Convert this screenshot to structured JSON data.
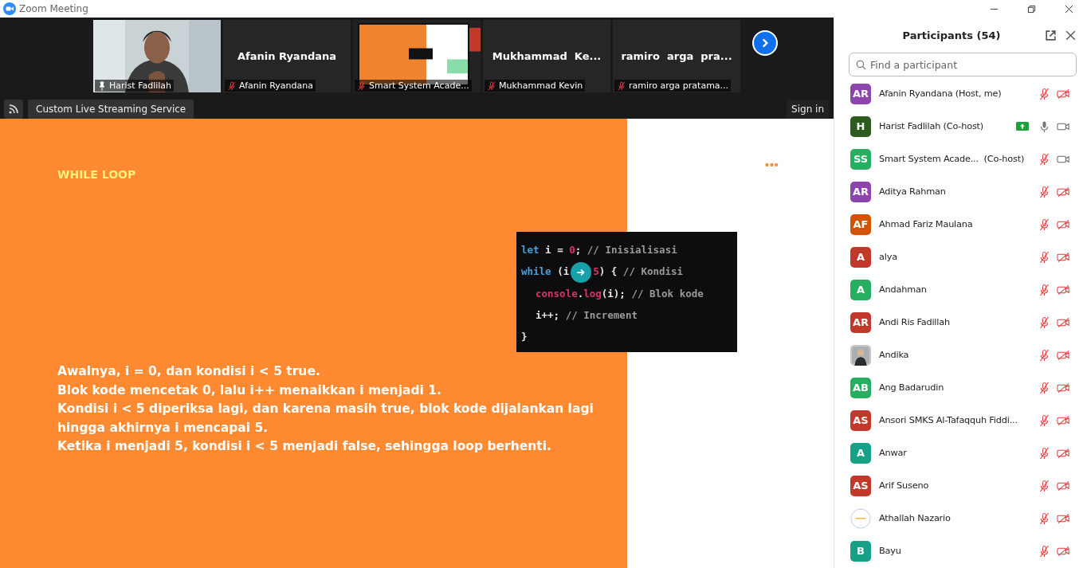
{
  "window": {
    "title": "Zoom Meeting"
  },
  "gallery": [
    {
      "kind": "video",
      "name": "Harist Fadlilah",
      "pinned": true,
      "muted": false,
      "active": true
    },
    {
      "kind": "name",
      "title": "Afanin Ryandana",
      "name": "Afanin Ryandana",
      "pinned": false,
      "muted": true,
      "active": false
    },
    {
      "kind": "screen",
      "name": "Smart System Acade...",
      "pinned": false,
      "muted": true,
      "active": false
    },
    {
      "kind": "name",
      "title": "Mukhammad  Ke...",
      "name": "Mukhammad Kevin",
      "pinned": false,
      "muted": true,
      "active": false
    },
    {
      "kind": "name",
      "title": "ramiro  arga  pra...",
      "name": "ramiro arga pratama...",
      "pinned": false,
      "muted": true,
      "active": false
    }
  ],
  "streaming": {
    "label": "Custom Live Streaming Service"
  },
  "sign_in": "Sign in",
  "slide": {
    "heading": "WHILE LOOP",
    "more": "•••",
    "code": [
      [
        {
          "kind": "keyword",
          "text": "let"
        },
        {
          "kind": "plain",
          "text": " i = "
        },
        {
          "kind": "number",
          "text": "0"
        },
        {
          "kind": "plain",
          "text": "; "
        },
        {
          "kind": "comment",
          "text": "// Inisialisasi"
        }
      ],
      [
        {
          "kind": "keyword",
          "text": "while"
        },
        {
          "kind": "plain",
          "text": " (i"
        },
        {
          "kind": "cursor"
        },
        {
          "kind": "number",
          "text": "5"
        },
        {
          "kind": "plain",
          "text": ") { "
        },
        {
          "kind": "comment",
          "text": "// Kondisi"
        }
      ],
      [
        {
          "kind": "indent"
        },
        {
          "kind": "func",
          "text": "console"
        },
        {
          "kind": "plain",
          "text": "."
        },
        {
          "kind": "func",
          "text": "log"
        },
        {
          "kind": "plain",
          "text": "(i); "
        },
        {
          "kind": "comment",
          "text": "// Blok kode"
        }
      ],
      [
        {
          "kind": "indent"
        },
        {
          "kind": "plain",
          "text": "i++; "
        },
        {
          "kind": "comment",
          "text": "// Increment"
        }
      ],
      [
        {
          "kind": "plain",
          "text": "}"
        }
      ]
    ],
    "lines": [
      "Awalnya, i = 0, dan kondisi i < 5 true.",
      "Blok kode mencetak 0, lalu i++ menaikkan i menjadi 1.",
      "Kondisi i < 5 diperiksa lagi, dan karena masih true, blok kode dijalankan lagi hingga akhirnya i mencapai 5.",
      "Ketika i menjadi 5, kondisi i < 5 menjadi false, sehingga loop berhenti."
    ]
  },
  "participants": {
    "title": "Participants (54)",
    "search": {
      "placeholder": "Find a participant"
    },
    "items": [
      {
        "avatar": {
          "kind": "initials",
          "text": "AR",
          "color": "#8e44ad"
        },
        "name": "Afanin Ryandana (Host, me)",
        "sharing": false,
        "mic_on": false,
        "video_on": false
      },
      {
        "avatar": {
          "kind": "initials",
          "text": "H",
          "color": "#2e5c1e"
        },
        "name": "Harist Fadlilah (Co-host)",
        "sharing": true,
        "mic_on": true,
        "video_on": true
      },
      {
        "avatar": {
          "kind": "initials",
          "text": "SS",
          "color": "#27ae60"
        },
        "name": "Smart System Acade...  (Co-host)",
        "sharing": false,
        "mic_on": false,
        "video_on": true
      },
      {
        "avatar": {
          "kind": "initials",
          "text": "AR",
          "color": "#8e44ad"
        },
        "name": "Aditya Rahman",
        "sharing": false,
        "mic_on": false,
        "video_on": false
      },
      {
        "avatar": {
          "kind": "initials",
          "text": "AF",
          "color": "#d35400"
        },
        "name": "Ahmad Fariz Maulana",
        "sharing": false,
        "mic_on": false,
        "video_on": false
      },
      {
        "avatar": {
          "kind": "initials",
          "text": "A",
          "color": "#c0392b"
        },
        "name": "alya",
        "sharing": false,
        "mic_on": false,
        "video_on": false
      },
      {
        "avatar": {
          "kind": "initials",
          "text": "A",
          "color": "#27ae60"
        },
        "name": "Andahman",
        "sharing": false,
        "mic_on": false,
        "video_on": false
      },
      {
        "avatar": {
          "kind": "initials",
          "text": "AR",
          "color": "#c0392b"
        },
        "name": "Andi Ris Fadillah",
        "sharing": false,
        "mic_on": false,
        "video_on": false
      },
      {
        "name": "Andika",
        "sharing": false,
        "mic_on": false,
        "video_on": false
      },
      {
        "avatar": {
          "kind": "initials",
          "text": "AB",
          "color": "#27ae60"
        },
        "name": "Ang Badarudin",
        "sharing": false,
        "mic_on": false,
        "video_on": false
      },
      {
        "avatar": {
          "kind": "initials",
          "text": "AS",
          "color": "#c0392b"
        },
        "name": "Ansori SMKS Al-Tafaqquh Fiddi...",
        "sharing": false,
        "mic_on": false,
        "video_on": false
      },
      {
        "avatar": {
          "kind": "initials",
          "text": "A",
          "color": "#16a085"
        },
        "name": "Anwar",
        "sharing": false,
        "mic_on": false,
        "video_on": false
      },
      {
        "avatar": {
          "kind": "initials",
          "text": "AS",
          "color": "#c0392b"
        },
        "name": "Arif Suseno",
        "sharing": false,
        "mic_on": false,
        "video_on": false
      },
      {
        "avatar": {
          "kind": "logo"
        },
        "name": "Athallah Nazario",
        "sharing": false,
        "mic_on": false,
        "video_on": false
      },
      {
        "avatar": {
          "kind": "initials",
          "text": "B",
          "color": "#16a085"
        },
        "name": "Bayu",
        "sharing": false,
        "mic_on": false,
        "video_on": false
      }
    ]
  }
}
